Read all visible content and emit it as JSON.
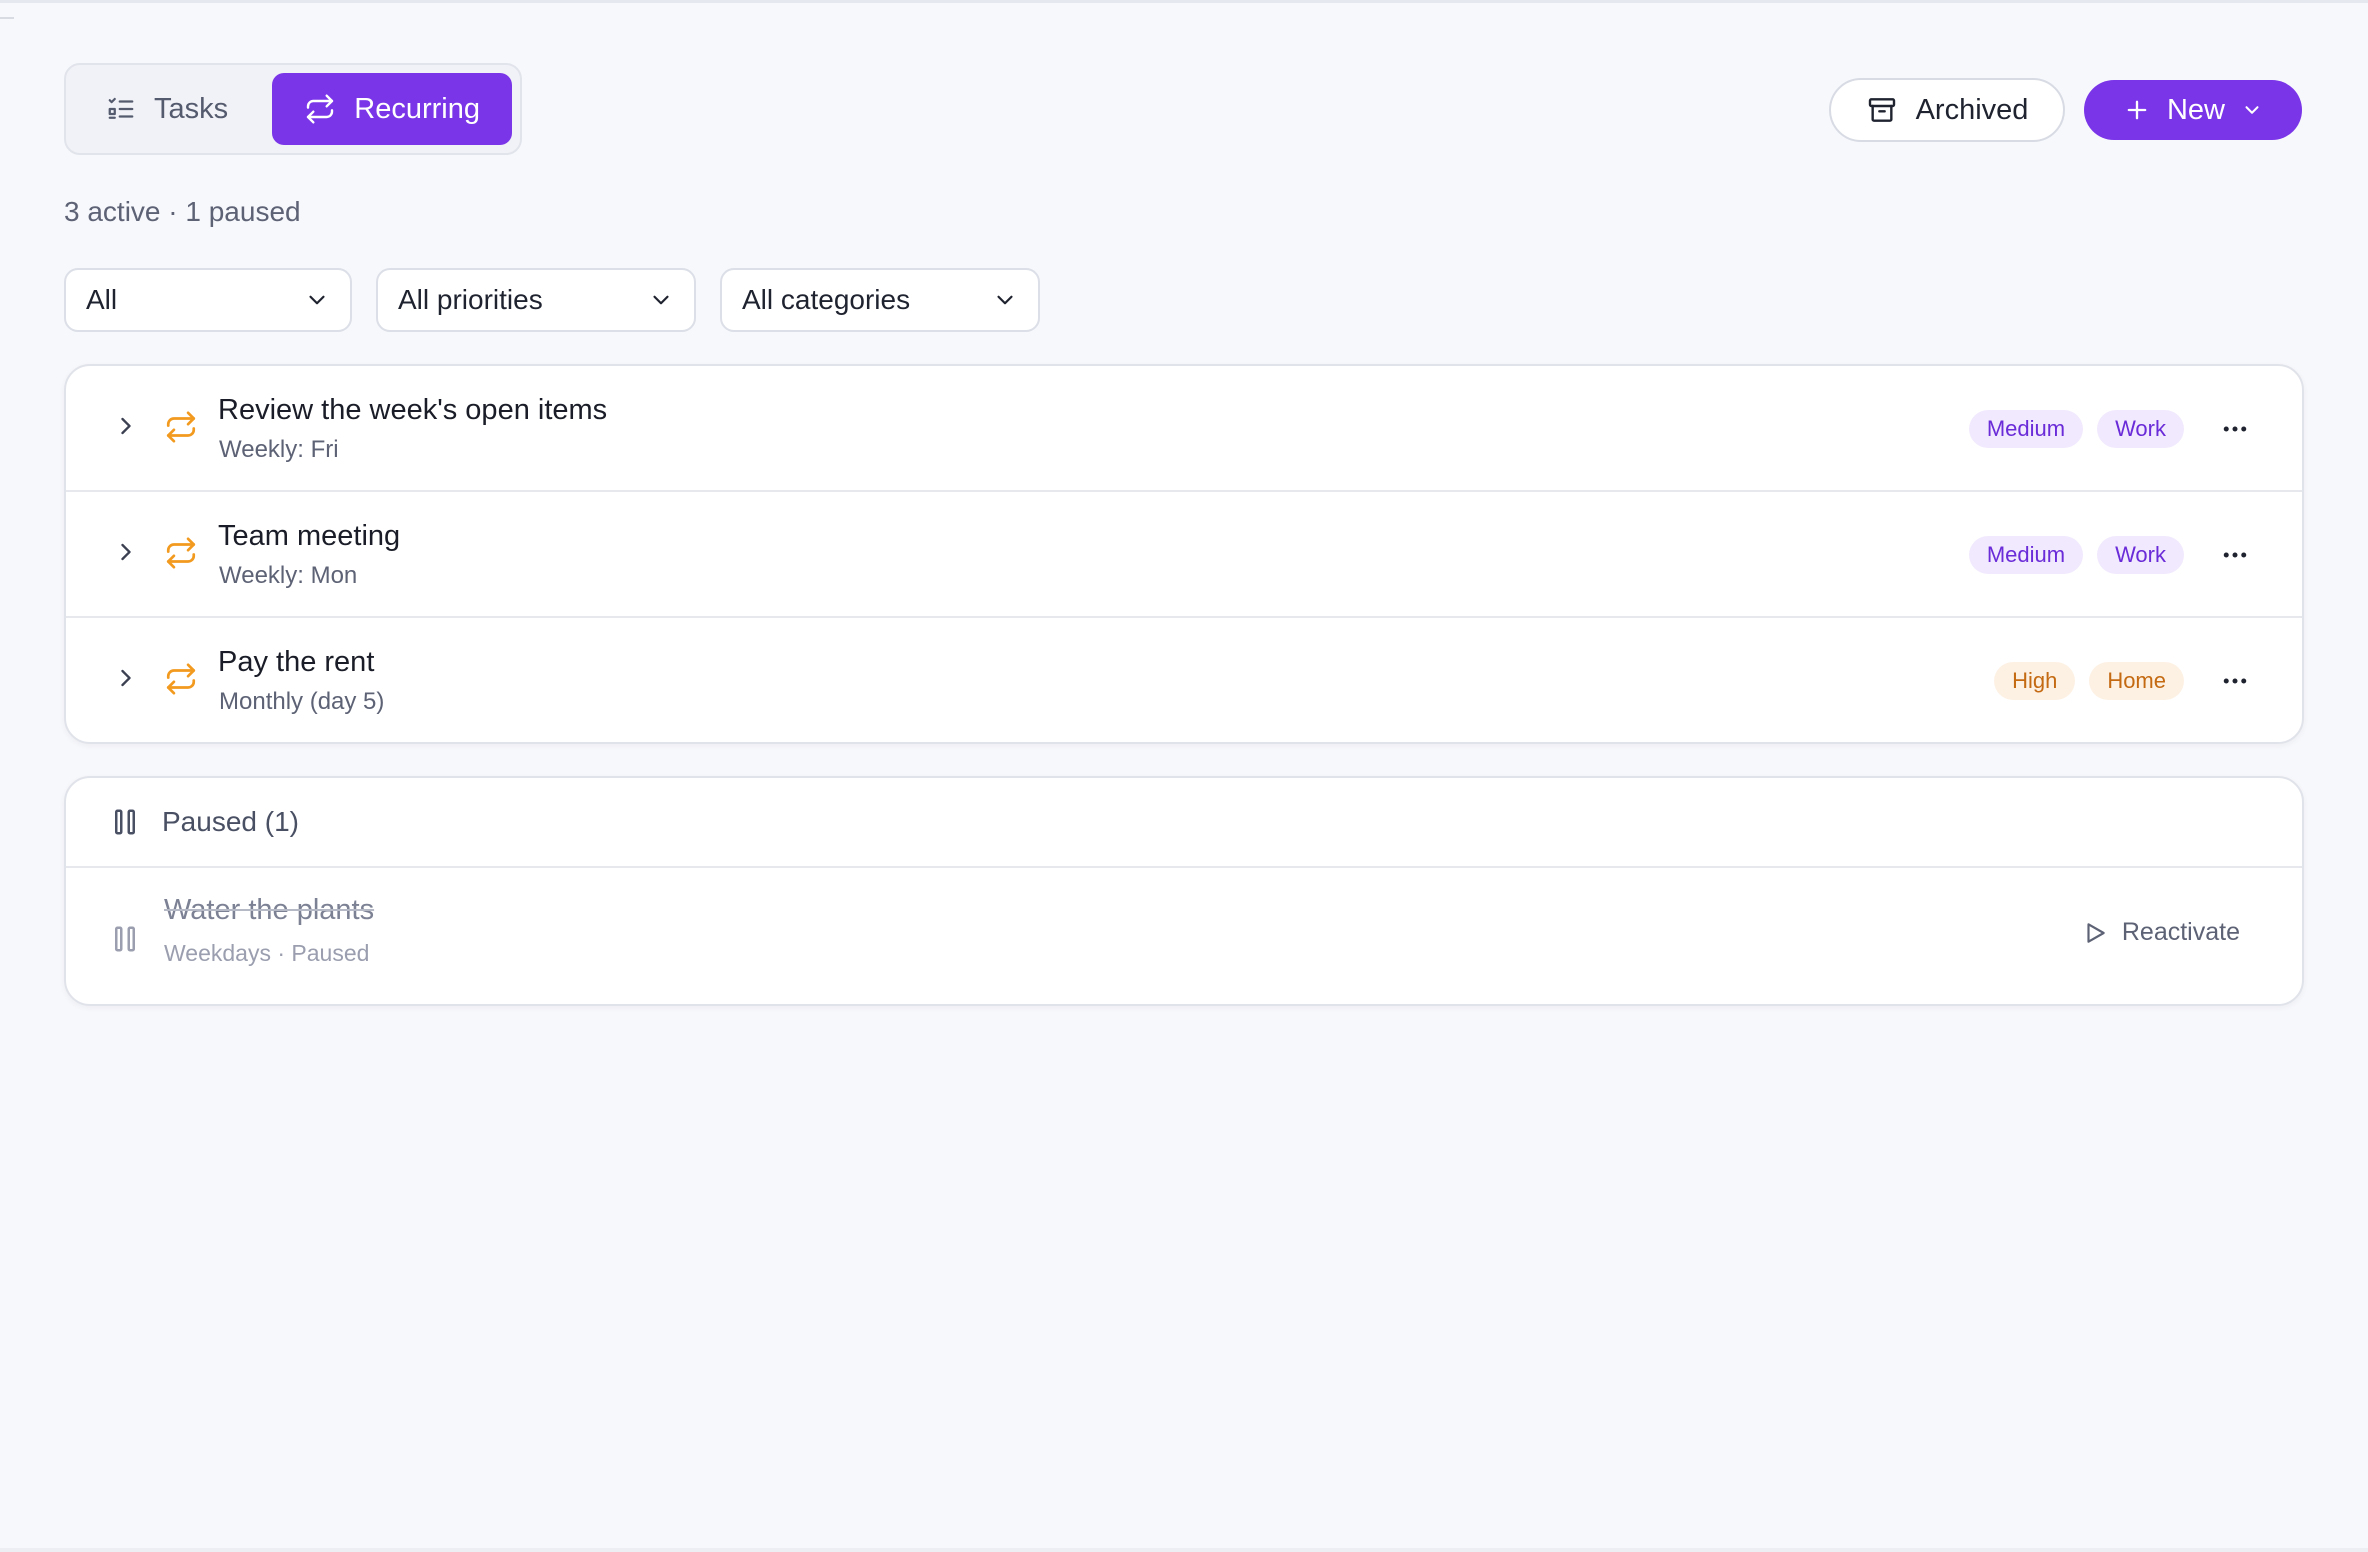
{
  "tabs": [
    {
      "label": "Tasks",
      "icon": "list-checks-icon",
      "active": false
    },
    {
      "label": "Recurring",
      "icon": "repeat-icon",
      "active": true
    }
  ],
  "actions": {
    "archived_label": "Archived",
    "new_label": "New"
  },
  "summary": "3 active · 1 paused",
  "filters": {
    "status": "All",
    "priority": "All priorities",
    "category": "All categories"
  },
  "active_items": [
    {
      "title": "Review the week's open items",
      "schedule": "Weekly: Fri",
      "priority": "Medium",
      "category": "Work",
      "color": "#7a35e8"
    },
    {
      "title": "Team meeting",
      "schedule": "Weekly: Mon",
      "priority": "Medium",
      "category": "Work",
      "color": "#7a35e8"
    },
    {
      "title": "Pay the rent",
      "schedule": "Monthly (day 5)",
      "priority": "High",
      "category": "Home",
      "color": "#c46a12"
    }
  ],
  "paused": {
    "header": "Paused (1)",
    "items": [
      {
        "title": "Water the plants",
        "schedule": "Weekdays · Paused",
        "action": "Reactivate"
      }
    ]
  },
  "colors": {
    "accent": "#7a35e8",
    "recurring_icon": "#f29a1f",
    "background": "#f7f8fc"
  }
}
